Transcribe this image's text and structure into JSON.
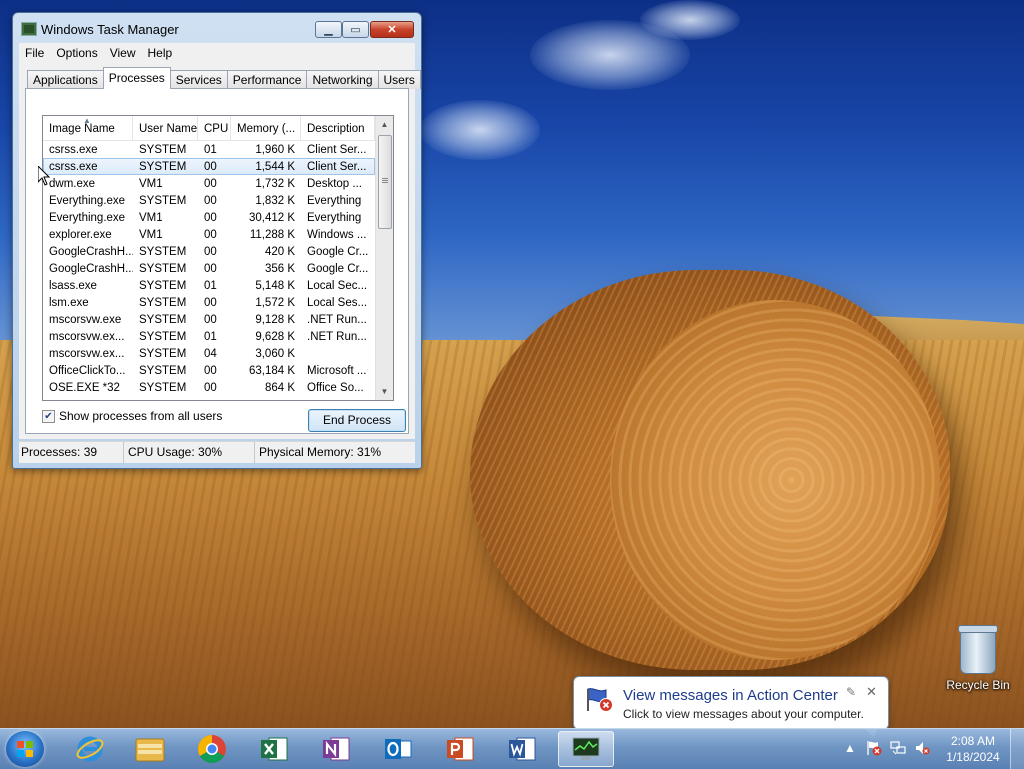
{
  "desktop": {
    "icons": [
      {
        "label": "Recycle Bin",
        "icon": "recycle-bin-icon"
      }
    ]
  },
  "task_manager": {
    "title": "Windows Task Manager",
    "window_buttons": {
      "minimize": "▁",
      "maximize": "▭",
      "close": "✕"
    },
    "menu": [
      "File",
      "Options",
      "View",
      "Help"
    ],
    "tabs": [
      "Applications",
      "Processes",
      "Services",
      "Performance",
      "Networking",
      "Users"
    ],
    "active_tab": "Processes",
    "columns": [
      "Image Name",
      "User Name",
      "CPU",
      "Memory (...",
      "Description"
    ],
    "rows": [
      {
        "name": "csrss.exe",
        "user": "SYSTEM",
        "cpu": "01",
        "memory": "1,960 K",
        "description": "Client Ser..."
      },
      {
        "name": "csrss.exe",
        "user": "SYSTEM",
        "cpu": "00",
        "memory": "1,544 K",
        "description": "Client Ser...",
        "selected": true
      },
      {
        "name": "dwm.exe",
        "user": "VM1",
        "cpu": "00",
        "memory": "1,732 K",
        "description": "Desktop ..."
      },
      {
        "name": "Everything.exe",
        "user": "SYSTEM",
        "cpu": "00",
        "memory": "1,832 K",
        "description": "Everything"
      },
      {
        "name": "Everything.exe",
        "user": "VM1",
        "cpu": "00",
        "memory": "30,412 K",
        "description": "Everything"
      },
      {
        "name": "explorer.exe",
        "user": "VM1",
        "cpu": "00",
        "memory": "11,288 K",
        "description": "Windows ..."
      },
      {
        "name": "GoogleCrashH...",
        "user": "SYSTEM",
        "cpu": "00",
        "memory": "420 K",
        "description": "Google Cr..."
      },
      {
        "name": "GoogleCrashH...",
        "user": "SYSTEM",
        "cpu": "00",
        "memory": "356 K",
        "description": "Google Cr..."
      },
      {
        "name": "lsass.exe",
        "user": "SYSTEM",
        "cpu": "01",
        "memory": "5,148 K",
        "description": "Local Sec..."
      },
      {
        "name": "lsm.exe",
        "user": "SYSTEM",
        "cpu": "00",
        "memory": "1,572 K",
        "description": "Local Ses..."
      },
      {
        "name": "mscorsvw.exe",
        "user": "SYSTEM",
        "cpu": "00",
        "memory": "9,128 K",
        "description": ".NET Run..."
      },
      {
        "name": "mscorsvw.ex...",
        "user": "SYSTEM",
        "cpu": "01",
        "memory": "9,628 K",
        "description": ".NET Run..."
      },
      {
        "name": "mscorsvw.ex...",
        "user": "SYSTEM",
        "cpu": "04",
        "memory": "3,060 K",
        "description": ""
      },
      {
        "name": "OfficeClickTo...",
        "user": "SYSTEM",
        "cpu": "00",
        "memory": "63,184 K",
        "description": "Microsoft ..."
      },
      {
        "name": "OSE.EXE *32",
        "user": "SYSTEM",
        "cpu": "00",
        "memory": "864 K",
        "description": "Office So..."
      }
    ],
    "show_all_label": "Show processes from all users",
    "show_all_checked": true,
    "end_process_label": "End Process",
    "status": {
      "processes": "Processes: 39",
      "cpu_usage": "CPU Usage: 30%",
      "physical_memory": "Physical Memory: 31%"
    }
  },
  "notification": {
    "title": "View messages in Action Center",
    "text": "Click to view messages about your computer.",
    "close": "✕",
    "pin": "✎"
  },
  "taskbar": {
    "start_icon": "windows-start-icon",
    "pinned": [
      {
        "name": "internet-explorer-icon",
        "color": "#2c8fdc"
      },
      {
        "name": "file-explorer-icon",
        "color": "#e8b94a"
      },
      {
        "name": "chrome-icon",
        "color": "#db4437"
      },
      {
        "name": "excel-icon",
        "color": "#1f7244"
      },
      {
        "name": "onenote-icon",
        "color": "#7b3a96"
      },
      {
        "name": "outlook-icon",
        "color": "#0f6cbd"
      },
      {
        "name": "powerpoint-icon",
        "color": "#c94a23"
      },
      {
        "name": "word-icon",
        "color": "#2b579a"
      },
      {
        "name": "task-manager-icon",
        "color": "#2b4e2b",
        "active": true
      }
    ],
    "tray": {
      "show_hidden": "▲",
      "time": "2:08 AM",
      "date": "1/18/2024"
    }
  }
}
